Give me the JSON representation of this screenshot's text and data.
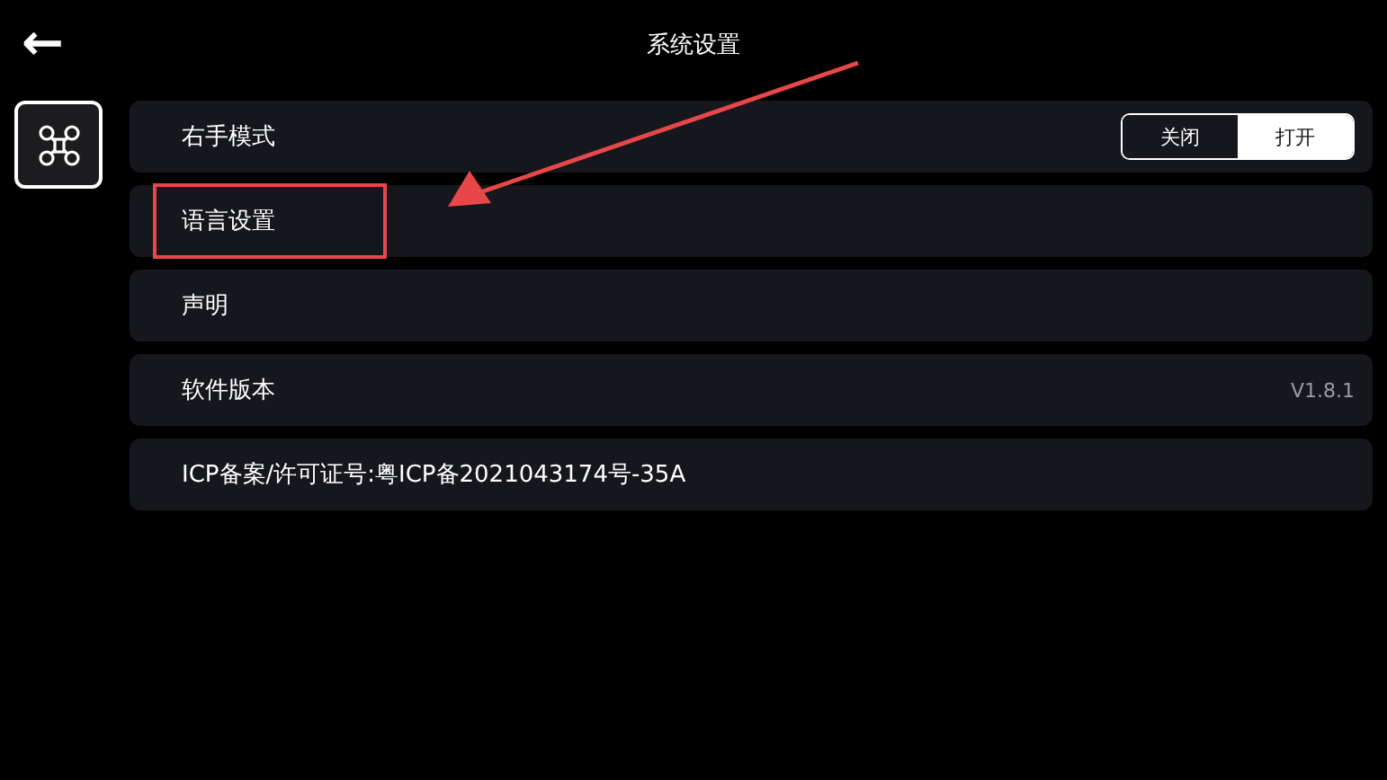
{
  "header": {
    "title": "系统设置",
    "back": "←"
  },
  "sidebar": {
    "items": [
      {
        "kind": "drone",
        "selected": true
      }
    ]
  },
  "rows": [
    {
      "kind": "toggle",
      "label": "右手模式",
      "highlighted": false,
      "options": [
        {
          "label": "关闭",
          "selected": false
        },
        {
          "label": "打开",
          "selected": true
        }
      ]
    },
    {
      "kind": "plain",
      "label": "语言设置",
      "highlighted": true
    },
    {
      "kind": "plain",
      "label": "声明",
      "highlighted": false
    },
    {
      "kind": "value",
      "label": "软件版本",
      "value": "V1.8.1",
      "highlighted": false
    },
    {
      "kind": "plain",
      "label": "ICP备案/许可证号:粤ICP备2021043174号-35A",
      "highlighted": false
    }
  ]
}
